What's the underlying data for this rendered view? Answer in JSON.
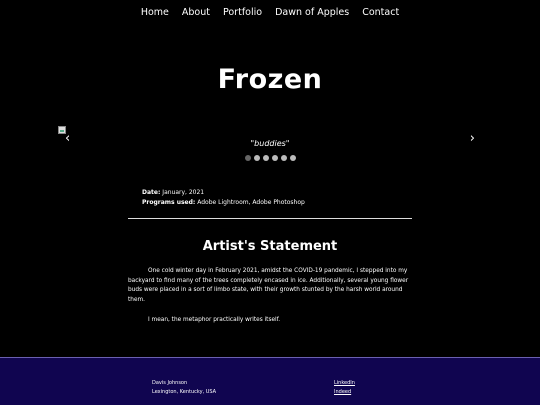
{
  "nav": {
    "items": [
      "Home",
      "About",
      "Portfolio",
      "Dawn of Apples",
      "Contact"
    ]
  },
  "page": {
    "title": "Frozen"
  },
  "slideshow": {
    "caption": "\"buddies\"",
    "prev_glyph": "‹",
    "next_glyph": "›",
    "dot_count": 6,
    "active_dot": 0
  },
  "meta": {
    "date_label": "Date:",
    "date_value": "January, 2021",
    "programs_label": "Programs used:",
    "programs_value": "Adobe Lightroom, Adobe Photoshop"
  },
  "statement": {
    "heading": "Artist's Statement",
    "paragraph1": "One cold winter day in February 2021, amidst the COVID-19 pandemic, I stepped into my backyard to find many of the trees completely encased in ice. Additionally, several young flower buds were placed in a sort of limbo state, with their growth stunted by the harsh world around them.",
    "paragraph2": "I mean, the metaphor practically writes itself."
  },
  "footer": {
    "name": "Davis Johnson",
    "location": "Lexington, Kentucky, USA",
    "links": [
      "LinkedIn",
      "Indeed"
    ]
  },
  "colors": {
    "background": "#000000",
    "footer": "#100550",
    "text": "#ffffff"
  }
}
